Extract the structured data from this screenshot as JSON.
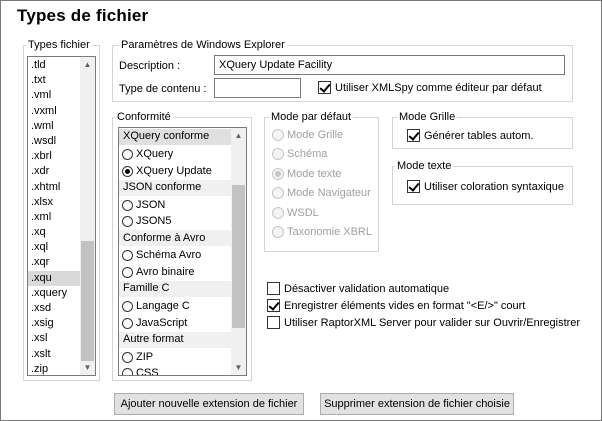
{
  "title": "Types de fichier",
  "file_types": {
    "legend": "Types fichier",
    "items": [
      ".tld",
      ".txt",
      ".vml",
      ".vxml",
      ".wml",
      ".wsdl",
      ".xbrl",
      ".xdr",
      ".xhtml",
      ".xlsx",
      ".xml",
      ".xq",
      ".xql",
      ".xqr",
      ".xqu",
      ".xquery",
      ".xsd",
      ".xsig",
      ".xsl",
      ".xslt",
      ".zip"
    ],
    "selected": ".xqu"
  },
  "explorer": {
    "legend": "Paramètres de Windows Explorer",
    "description_label": "Description :",
    "description_value": "XQuery Update Facility",
    "content_type_label": "Type de contenu :",
    "content_type_value": "",
    "default_editor_label": "Utiliser XMLSpy comme éditeur par défaut",
    "default_editor_checked": true
  },
  "conformity": {
    "legend": "Conformité",
    "rows": [
      {
        "kind": "head",
        "label": "XQuery conforme",
        "selected": true
      },
      {
        "kind": "item",
        "label": "XQuery",
        "checked": false
      },
      {
        "kind": "item",
        "label": "XQuery Update",
        "checked": true
      },
      {
        "kind": "head",
        "label": "JSON conforme",
        "selected": false
      },
      {
        "kind": "item",
        "label": "JSON",
        "checked": false
      },
      {
        "kind": "item",
        "label": "JSON5",
        "checked": false
      },
      {
        "kind": "head",
        "label": "Conforme à Avro",
        "selected": false
      },
      {
        "kind": "item",
        "label": "Schéma Avro",
        "checked": false
      },
      {
        "kind": "item",
        "label": "Avro binaire",
        "checked": false
      },
      {
        "kind": "head",
        "label": "Famille C",
        "selected": false
      },
      {
        "kind": "item",
        "label": "Langage C",
        "checked": false
      },
      {
        "kind": "item",
        "label": "JavaScript",
        "checked": false
      },
      {
        "kind": "head",
        "label": "Autre format",
        "selected": false
      },
      {
        "kind": "item",
        "label": "ZIP",
        "checked": false
      },
      {
        "kind": "item",
        "label": "CSS",
        "checked": false
      }
    ]
  },
  "default_mode": {
    "legend": "Mode par défaut",
    "options": [
      {
        "label": "Mode Grille",
        "checked": false
      },
      {
        "label": "Schéma",
        "checked": false
      },
      {
        "label": "Mode texte",
        "checked": true
      },
      {
        "label": "Mode Navigateur",
        "checked": false
      },
      {
        "label": "WSDL",
        "checked": false
      },
      {
        "label": "Taxonomie XBRL",
        "checked": false
      }
    ]
  },
  "grid_mode": {
    "legend": "Mode Grille",
    "auto_tables_label": "Générer tables autom.",
    "auto_tables_checked": true
  },
  "text_mode": {
    "legend": "Mode texte",
    "syntax_coloring_label": "Utiliser coloration syntaxique",
    "syntax_coloring_checked": true
  },
  "options": {
    "disable_validation_label": "Désactiver validation automatique",
    "disable_validation_checked": false,
    "save_empty_label": "Enregistrer éléments vides en format \"<E/>\" court",
    "save_empty_checked": true,
    "raptor_label": "Utiliser RaptorXML Server pour valider sur Ouvrir/Enregistrer",
    "raptor_checked": false
  },
  "buttons": {
    "add": "Ajouter nouvelle extension de fichier",
    "remove": "Supprimer extension de fichier choisie"
  }
}
